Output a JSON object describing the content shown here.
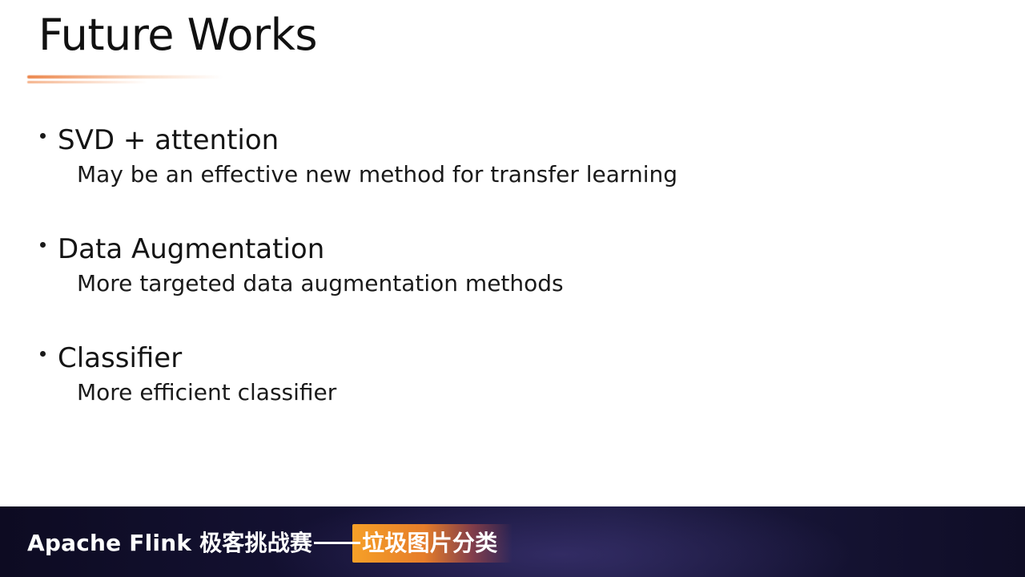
{
  "slide": {
    "title": "Future Works",
    "accent_color": "#E8712A",
    "bullets": [
      {
        "heading": "SVD + attention",
        "detail": "May be an effective new method for transfer learning"
      },
      {
        "heading": "Data Augmentation",
        "detail": "More targeted data augmentation methods"
      },
      {
        "heading": "Classifier",
        "detail": "More efficient classifier"
      }
    ]
  },
  "footer": {
    "brand": "Apache Flink 极客挑战赛",
    "subtitle": "垃圾图片分类",
    "highlight_color": "#F5A02A",
    "background_color": "#15123A"
  }
}
